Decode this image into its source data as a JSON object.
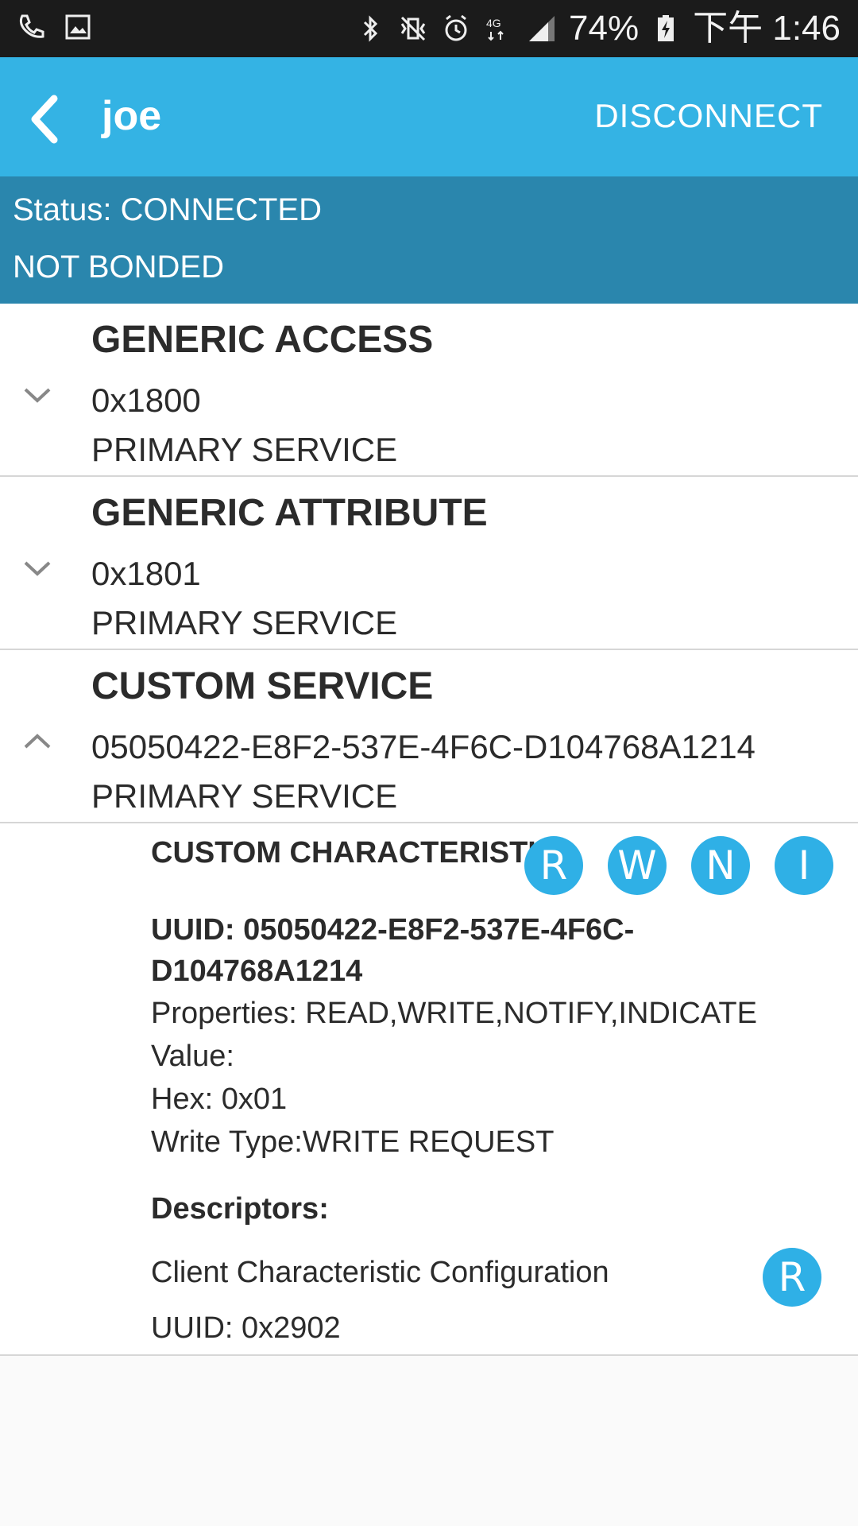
{
  "statusbar": {
    "battery": "74%",
    "time": "下午 1:46",
    "network": "4G"
  },
  "appbar": {
    "title": "joe",
    "disconnect_label": "DISCONNECT"
  },
  "connection": {
    "status": "Status: CONNECTED",
    "bond": "NOT BONDED"
  },
  "services": [
    {
      "name": "GENERIC ACCESS",
      "uuid": "0x1800",
      "type": "PRIMARY SERVICE",
      "expanded": false
    },
    {
      "name": "GENERIC ATTRIBUTE",
      "uuid": "0x1801",
      "type": "PRIMARY SERVICE",
      "expanded": false
    },
    {
      "name": "CUSTOM SERVICE",
      "uuid": "05050422-E8F2-537E-4F6C-D104768A1214",
      "type": "PRIMARY SERVICE",
      "expanded": true
    }
  ],
  "characteristic": {
    "name": "CUSTOM CHARACTERISTIC",
    "uuid": "UUID: 05050422-E8F2-537E-4F6C-D104768A1214",
    "properties": "Properties: READ,WRITE,NOTIFY,INDICATE",
    "value": "Value:",
    "hex": "Hex: 0x01",
    "write_type": "Write Type:WRITE REQUEST",
    "buttons": [
      "R",
      "W",
      "N",
      "I"
    ],
    "descriptors_title": "Descriptors:",
    "descriptor": {
      "name": "Client Characteristic Configuration",
      "uuid": "UUID: 0x2902",
      "button": "R"
    }
  },
  "colors": {
    "appbar": "#34b3e4",
    "statusband": "#2a86ad",
    "accent": "#2fb0e6"
  }
}
